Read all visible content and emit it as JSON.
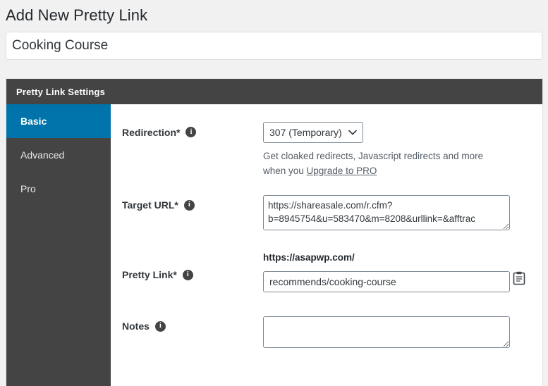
{
  "page": {
    "title": "Add New Pretty Link"
  },
  "title_field": {
    "value": "Cooking Course",
    "placeholder": "Enter title here"
  },
  "metabox": {
    "header": "Pretty Link Settings",
    "tabs": [
      {
        "label": "Basic",
        "active": true
      },
      {
        "label": "Advanced",
        "active": false
      },
      {
        "label": "Pro",
        "active": false
      }
    ]
  },
  "fields": {
    "redirection": {
      "label": "Redirection*",
      "info_icon": "info-icon",
      "selected": "307 (Temporary)",
      "options": [
        "307 (Temporary)"
      ],
      "helper_prefix": "Get cloaked redirects, Javascript redirects and more when you ",
      "helper_link": "Upgrade to PRO"
    },
    "target_url": {
      "label": "Target URL*",
      "info_icon": "info-icon",
      "value": "https://shareasale.com/r.cfm?b=8945754&u=583470&m=8208&urllink=&afftrac"
    },
    "pretty_link": {
      "label": "Pretty Link*",
      "info_icon": "info-icon",
      "prefix": "https://asapwp.com/",
      "value": "recommends/cooking-course",
      "copy_icon": "clipboard-icon"
    },
    "notes": {
      "label": "Notes",
      "info_icon": "info-icon",
      "value": "",
      "placeholder": ""
    }
  },
  "colors": {
    "accent": "#0073aa",
    "dark_panel": "#444444",
    "page_bg": "#f1f1f1",
    "text": "#32373c"
  }
}
